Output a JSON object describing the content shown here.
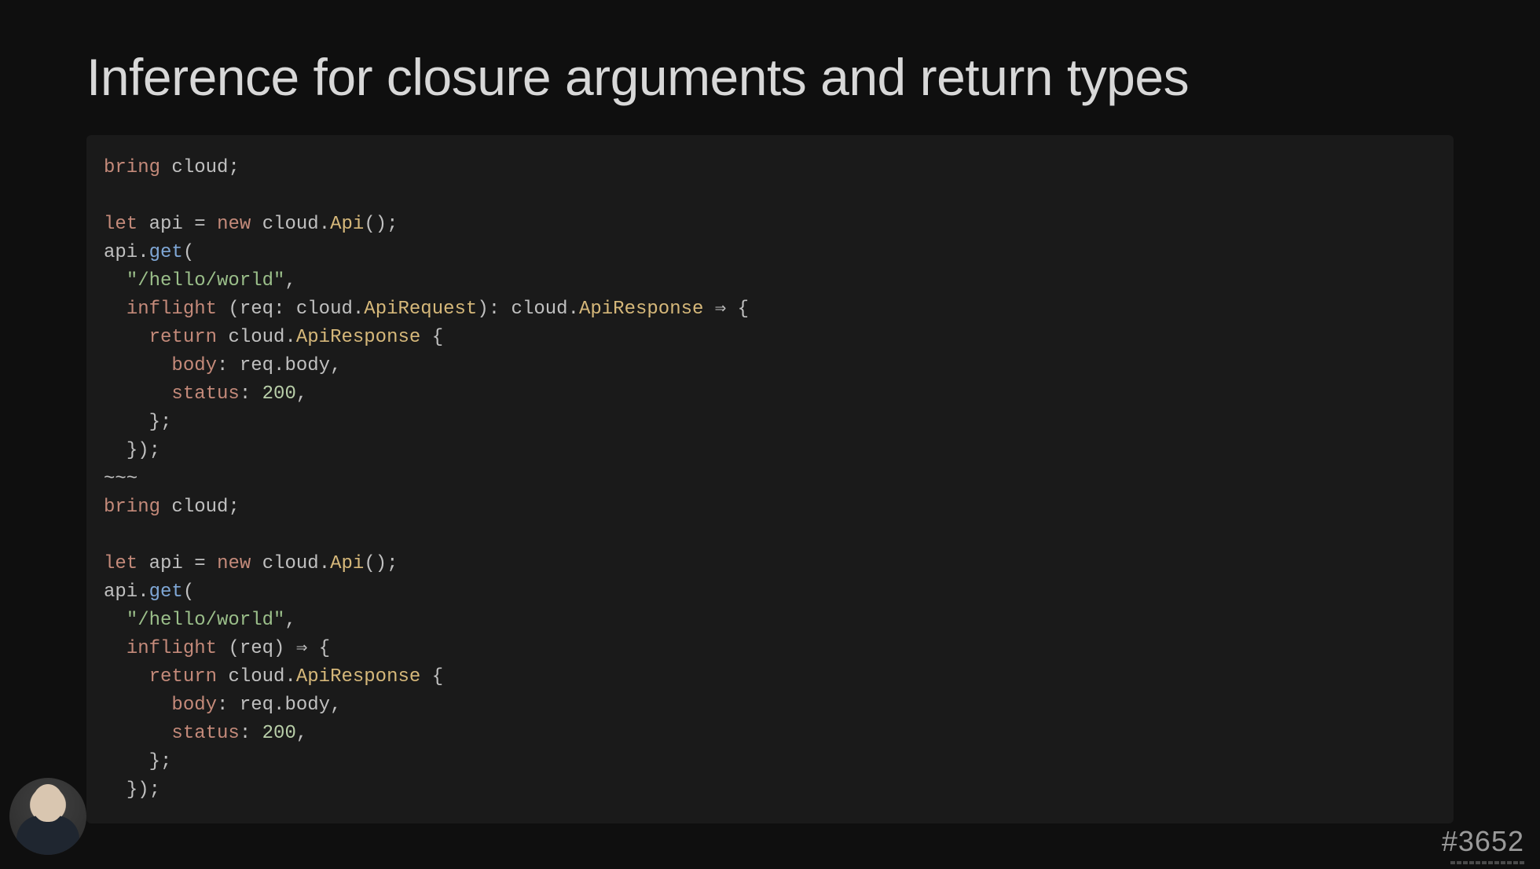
{
  "slide": {
    "title": "Inference for closure arguments and return types",
    "issue_ref": "#3652"
  },
  "code": {
    "block1": {
      "bring": "bring",
      "cloud": "cloud",
      "semi": ";",
      "let": "let",
      "api_ident": "api",
      "eq": " = ",
      "new": "new",
      "sp": " ",
      "dot": ".",
      "Api": "Api",
      "parens": "();",
      "get": "get",
      "open_paren": "(",
      "route": "\"/hello/world\"",
      "comma": ",",
      "inflight": "inflight",
      "req": "req",
      "colon": ":",
      "ApiRequest": "ApiRequest",
      "close_paren_colon": "): ",
      "ApiResponse": "ApiResponse",
      "arrow": " ⇒ {",
      "return": "return",
      "open_brace": " {",
      "body_key": "body",
      "body_val": "req.body",
      "status_key": "status",
      "status_val": "200",
      "close_brace_semi": "};",
      "close_fn": "});",
      "separator": "~~~"
    },
    "block2": {
      "inflight_simple": "inflight",
      "req_simple": "(req) ⇒ {"
    }
  }
}
